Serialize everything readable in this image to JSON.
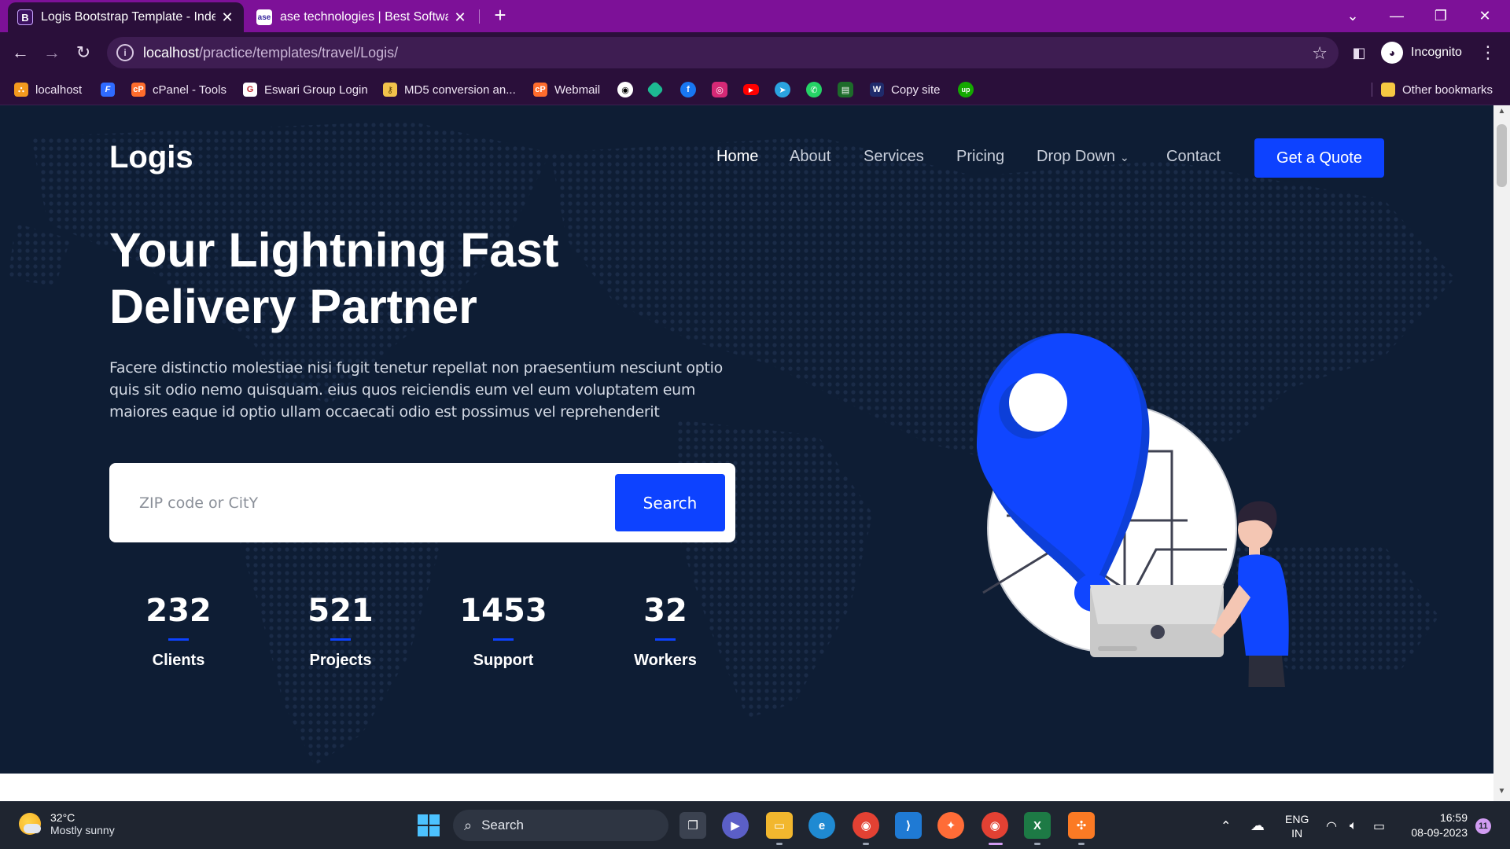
{
  "browser": {
    "tabs": [
      {
        "title": "Logis Bootstrap Template - Index",
        "favicon": "B",
        "active": true
      },
      {
        "title": "ase technologies | Best Software",
        "favicon": "ase",
        "active": false
      }
    ],
    "new_tab_glyph": "+",
    "address": {
      "host": "localhost",
      "path": "/practice/templates/travel/Logis/"
    },
    "profile_label": "Incognito",
    "bookmarks": [
      {
        "label": "localhost",
        "icon": "xampp-icon",
        "color": "#f39a1e"
      },
      {
        "label": "",
        "icon": "f-icon",
        "color": "#2f6bff"
      },
      {
        "label": "cPanel - Tools",
        "icon": "cpanel-icon",
        "color": "#ff6c2c"
      },
      {
        "label": "Eswari Group Login",
        "icon": "eswari-icon",
        "color": "#ffffff"
      },
      {
        "label": "MD5 conversion an...",
        "icon": "key-icon",
        "color": "#f2c24b"
      },
      {
        "label": "Webmail",
        "icon": "cpanel-icon",
        "color": "#ff6c2c"
      },
      {
        "label": "Copy site",
        "icon": "w-icon",
        "color": "#1f2b6b"
      }
    ],
    "other_bookmarks": "Other bookmarks"
  },
  "page": {
    "logo": "Logis",
    "nav": [
      {
        "label": "Home",
        "current": true
      },
      {
        "label": "About",
        "current": false
      },
      {
        "label": "Services",
        "current": false
      },
      {
        "label": "Pricing",
        "current": false
      },
      {
        "label": "Drop Down",
        "current": false,
        "dropdown": true
      },
      {
        "label": "Contact",
        "current": false
      }
    ],
    "cta": "Get a Quote",
    "hero_title_line1": "Your Lightning Fast",
    "hero_title_line2": "Delivery Partner",
    "hero_desc": "Facere distinctio molestiae nisi fugit tenetur repellat non praesentium nesciunt optio quis sit odio nemo quisquam. eius quos reiciendis eum vel eum voluptatem eum maiores eaque id optio ullam occaecati odio est possimus vel reprehenderit",
    "search": {
      "placeholder": "ZIP code or CitY",
      "value": "",
      "button": "Search"
    },
    "stats": [
      {
        "value": "232",
        "label": "Clients"
      },
      {
        "value": "521",
        "label": "Projects"
      },
      {
        "value": "1453",
        "label": "Support"
      },
      {
        "value": "32",
        "label": "Workers"
      }
    ],
    "colors": {
      "background": "#0e1d34",
      "accent": "#0d42ff"
    }
  },
  "taskbar": {
    "weather_temp": "32°C",
    "weather_desc": "Mostly sunny",
    "search_label": "Search",
    "lang_top": "ENG",
    "lang_bottom": "IN",
    "time": "16:59",
    "date": "08-09-2023",
    "notifications": "11"
  }
}
